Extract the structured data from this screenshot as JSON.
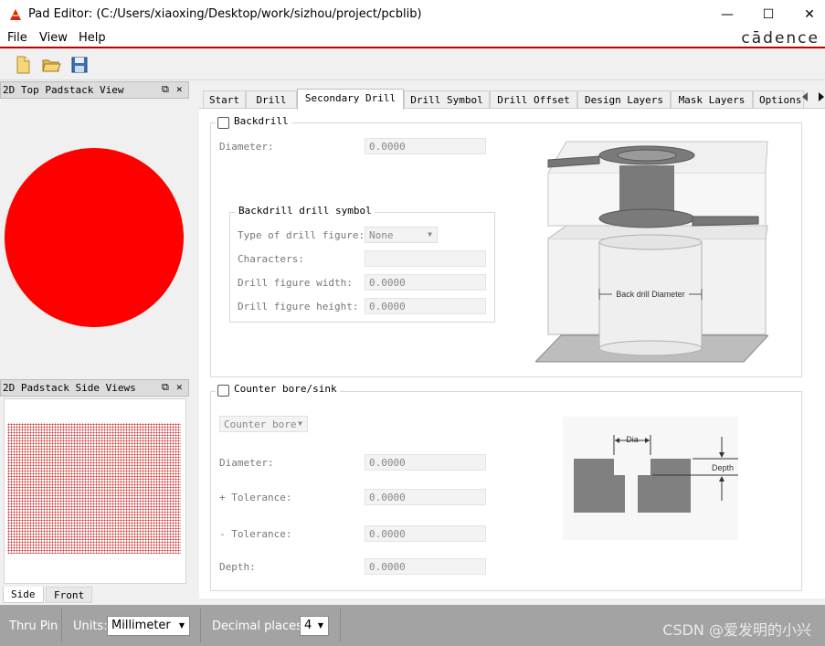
{
  "window": {
    "title": "Pad Editor:   (C:/Users/xiaoxing/Desktop/work/sizhou/project/pcblib)",
    "minimize": "—",
    "maximize": "☐",
    "close": "✕"
  },
  "menu": {
    "items": [
      "File",
      "View",
      "Help"
    ],
    "brand": "cādence"
  },
  "left_panel": {
    "top_title": "2D Top Padstack View",
    "side_title": "2D Padstack Side Views",
    "pin_glyph": "⧉",
    "close_glyph": "✕",
    "bottom_tabs": [
      "Side",
      "Front"
    ],
    "pad_color": "#ff0000"
  },
  "tabs": [
    "Start",
    "Drill",
    "Secondary Drill",
    "Drill Symbol",
    "Drill Offset",
    "Design Layers",
    "Mask Layers",
    "Options"
  ],
  "active_tab": "Secondary Drill",
  "backdrill": {
    "title": "Backdrill",
    "diameter_label": "Diameter:",
    "diameter_value": "0.0000",
    "symbol_group": "Backdrill drill symbol",
    "type_label": "Type of drill figure:",
    "type_value": "None",
    "characters_label": "Characters:",
    "characters_value": "",
    "width_label": "Drill figure width:",
    "width_value": "0.0000",
    "height_label": "Drill figure height:",
    "height_value": "0.0000",
    "diagram_label": "Back drill Diameter"
  },
  "counterbore": {
    "title": "Counter bore/sink",
    "mode_value": "Counter bore",
    "diameter_label": "Diameter:",
    "diameter_value": "0.0000",
    "plus_tol_label": "+ Tolerance:",
    "plus_tol_value": "0.0000",
    "minus_tol_label": "- Tolerance:",
    "minus_tol_value": "0.0000",
    "depth_label": "Depth:",
    "depth_value": "0.0000",
    "diagram_dia": "Dia",
    "diagram_depth": "Depth"
  },
  "status": {
    "pin_type": "Thru Pin",
    "units_label": "Units:",
    "units_value": "Millimeter",
    "decimal_label": "Decimal places:",
    "decimal_value": "4",
    "watermark": "CSDN @爱发明的小兴"
  }
}
